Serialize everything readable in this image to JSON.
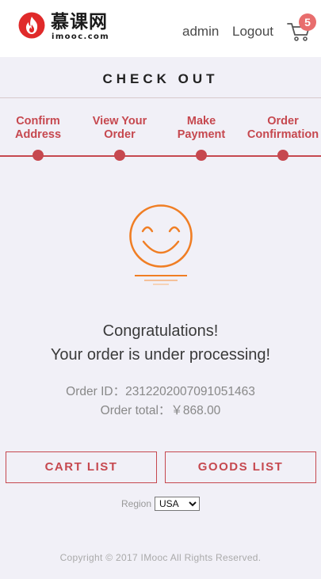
{
  "header": {
    "logo_text": "慕课网",
    "logo_sub": "imooc.com",
    "admin_label": "admin",
    "logout_label": "Logout",
    "cart_count": "5",
    "cart_icon": "cart-icon",
    "logo_icon": "flame-logo-icon"
  },
  "page": {
    "title": "CHECK OUT"
  },
  "steps": [
    {
      "label": "Confirm Address"
    },
    {
      "label": "View Your Order"
    },
    {
      "label": "Make Payment"
    },
    {
      "label": "Order Confirmation"
    }
  ],
  "result": {
    "icon": "smile-icon",
    "congrats": "Congratulations!",
    "message": "Your order is under processing!",
    "order_id_text": "Order ID：2312202007091051463",
    "order_total_text": "Order total：￥868.00"
  },
  "actions": {
    "cart_list": "CART LIST",
    "goods_list": "GOODS LIST"
  },
  "footer": {
    "region_label": "Region",
    "region_selected": "USA",
    "copyright": "Copyright © 2017 IMooc All Rights Reserved."
  },
  "colors": {
    "accent": "#c6484f",
    "logo_red": "#e02a2a",
    "smile_orange": "#f07e24",
    "background": "#f1f0f7",
    "badge": "#e86d6d"
  }
}
